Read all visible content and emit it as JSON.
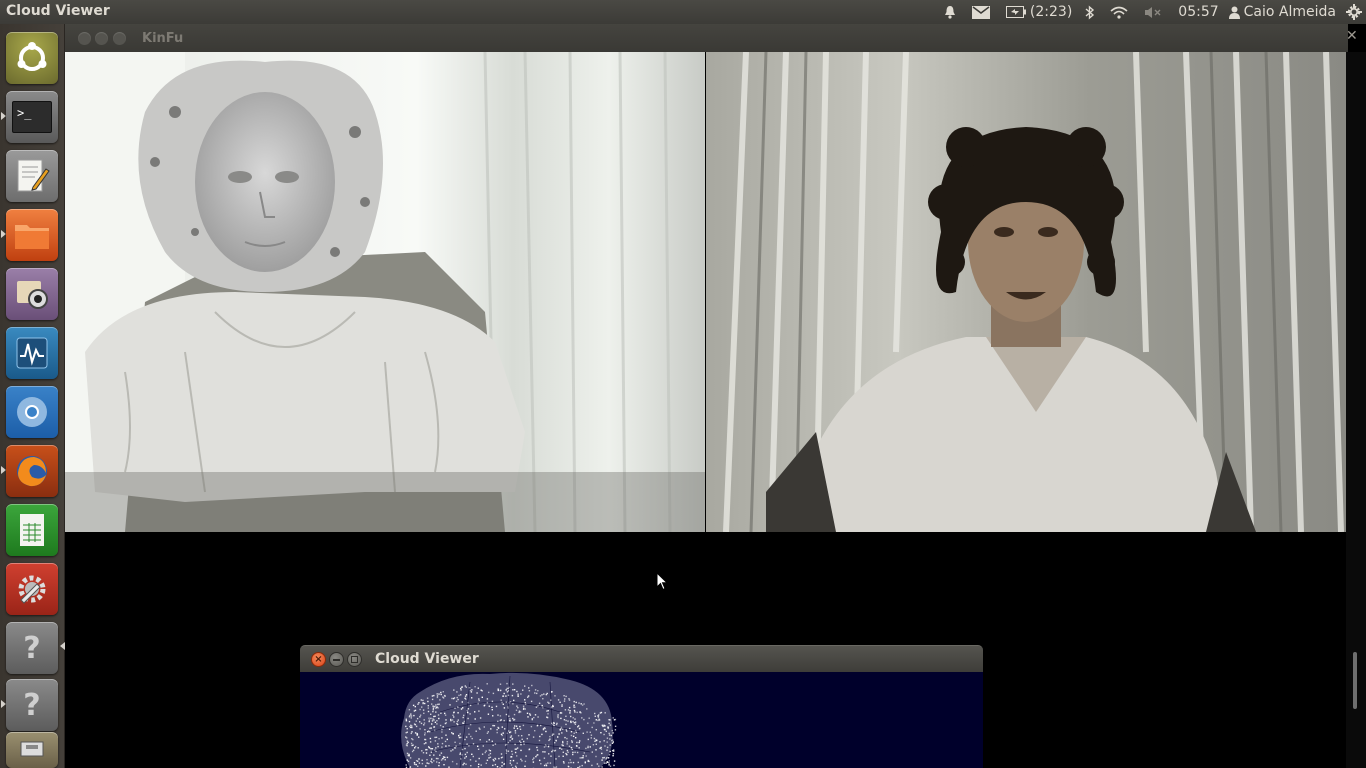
{
  "top_panel": {
    "app_title": "Cloud Viewer",
    "battery_text": "(2:23)",
    "clock": "05:57",
    "user_name": "Caio Almeida",
    "icons": [
      "bell-icon",
      "mail-icon",
      "battery-icon",
      "bluetooth-icon",
      "wifi-icon",
      "volume-muted-icon",
      "user-icon",
      "gear-icon"
    ]
  },
  "launcher": {
    "items": [
      {
        "name": "ubuntu-home",
        "icon": "dash-home-icon"
      },
      {
        "name": "terminal",
        "icon": "terminal-icon"
      },
      {
        "name": "text-editor",
        "icon": "text-editor-icon"
      },
      {
        "name": "files",
        "icon": "folder-icon"
      },
      {
        "name": "webcam",
        "icon": "webcam-icon"
      },
      {
        "name": "system-monitor",
        "icon": "system-monitor-icon"
      },
      {
        "name": "chromium",
        "icon": "chromium-icon"
      },
      {
        "name": "firefox",
        "icon": "firefox-icon"
      },
      {
        "name": "spreadsheet",
        "icon": "spreadsheet-icon"
      },
      {
        "name": "system-settings",
        "icon": "settings-icon"
      },
      {
        "name": "unknown-app-1",
        "icon": "question-icon"
      },
      {
        "name": "unknown-app-2",
        "icon": "question-icon"
      },
      {
        "name": "removable-drive",
        "icon": "drive-icon"
      }
    ]
  },
  "kinfu_window": {
    "title": "KinFu",
    "close_glyph": "✕",
    "scrollbar_thumb": {
      "position": 0.91,
      "size": 0.08
    }
  },
  "cloud_window": {
    "title": "Cloud Viewer"
  },
  "colors": {
    "panel_bg": "#3c3b37",
    "launcher_bg": "#3d3832",
    "close_button": "#e0501e",
    "cloud_canvas_bg": "#00002b"
  }
}
